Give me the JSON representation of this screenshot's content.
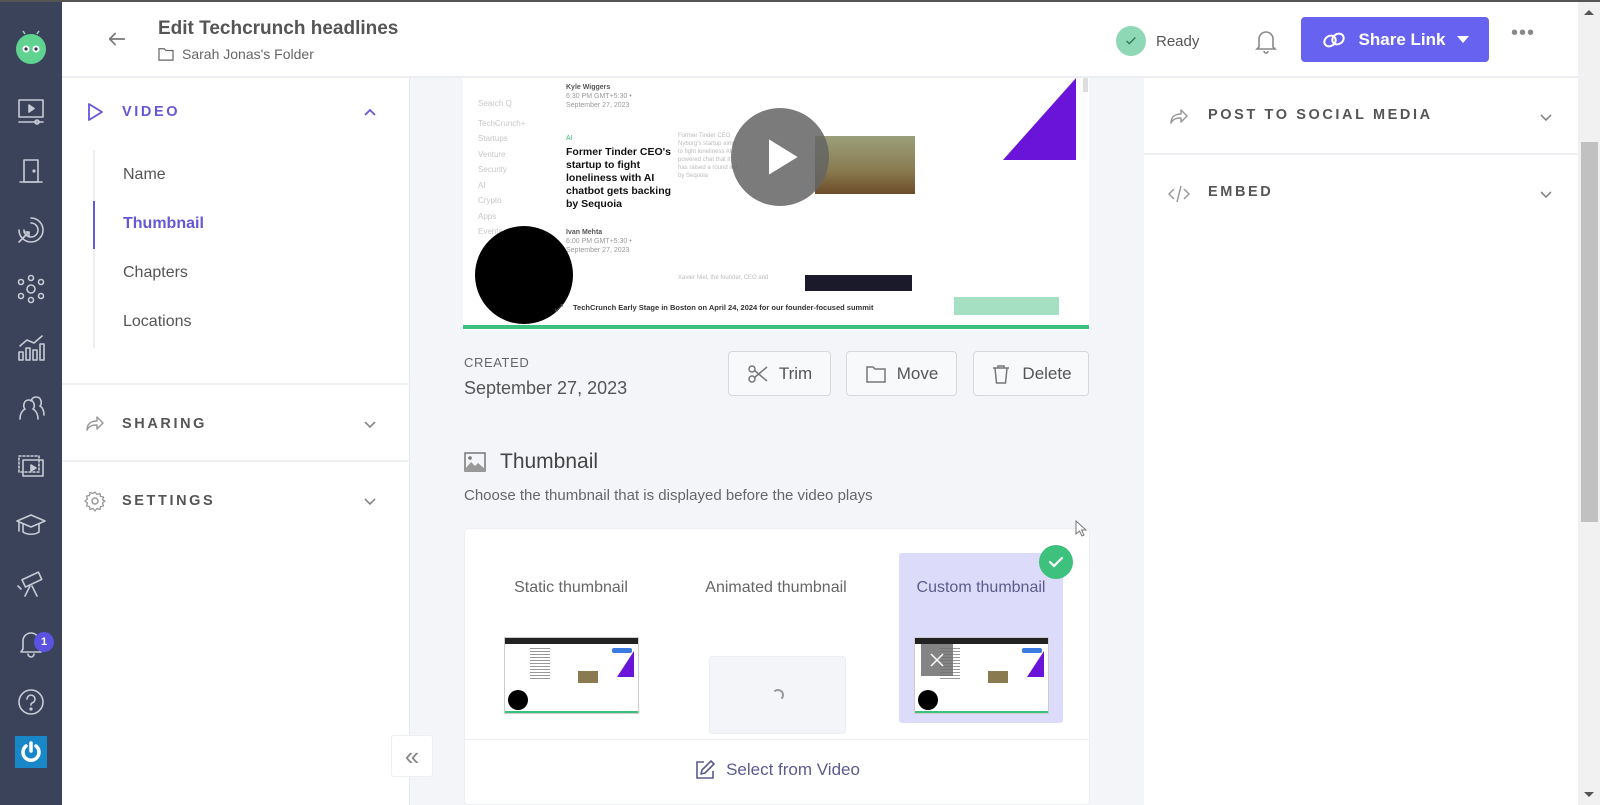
{
  "header": {
    "title": "Edit Techcrunch headlines",
    "folder": "Sarah Jonas's Folder",
    "status": "Ready",
    "share_label": "Share Link",
    "more_label": "•••"
  },
  "rail": {
    "items": [
      "videos-icon",
      "door-icon",
      "target-icon",
      "network-icon",
      "analytics-icon",
      "team-icon",
      "library-icon",
      "academy-icon",
      "telescope-icon",
      "notifications-icon",
      "help-icon"
    ],
    "notification_count": "1"
  },
  "left_panel": {
    "video_section": "VIDEO",
    "sub_items": [
      "Name",
      "Thumbnail",
      "Chapters",
      "Locations"
    ],
    "active_sub_item": "Thumbnail",
    "sharing_section": "SHARING",
    "settings_section": "SETTINGS",
    "collapse_label": "«"
  },
  "video_preview": {
    "nav_items": [
      "Search Q",
      "TechCrunch+",
      "Startups",
      "Venture",
      "Security",
      "AI",
      "Crypto",
      "Apps",
      "Events"
    ],
    "author1": "Kyle Wiggers",
    "date1": "6:30 PM GMT+5:30 • September 27, 2023",
    "category": "AI",
    "headline": "Former Tinder CEO's startup to fight loneliness with AI chatbot gets backing by Sequoia",
    "author2": "Ivan Mehta",
    "date2": "6:00 PM GMT+5:30 • September 27, 2023",
    "body": "Former Tinder CEO Nyborg's startup aims to fight loneliness AI-powered chat that it has raised a round led by Sequoia",
    "body2": "Xavier Niel, the founder, CEO and",
    "ticker": "TechCrunch Early Stage in Boston on April 24, 2024 for our founder-focused summit",
    "progress": 1.0
  },
  "details": {
    "created_label": "CREATED",
    "created_value": "September 27, 2023",
    "trim_label": "Trim",
    "move_label": "Move",
    "delete_label": "Delete"
  },
  "thumbnail": {
    "title": "Thumbnail",
    "description": "Choose the thumbnail that is displayed before the video plays",
    "options": [
      {
        "label": "Static thumbnail",
        "selected": false
      },
      {
        "label": "Animated thumbnail",
        "selected": false,
        "loading": true
      },
      {
        "label": "Custom thumbnail",
        "selected": true
      }
    ],
    "select_from_video": "Select from Video"
  },
  "right_panel": {
    "post_social": "POST TO SOCIAL MEDIA",
    "embed": "EMBED"
  },
  "colors": {
    "accent": "#6762f0",
    "active_text": "#6558d6",
    "success": "#3ec17c",
    "rail_bg": "#3b435a",
    "selected_bg": "#dcdcfa"
  }
}
